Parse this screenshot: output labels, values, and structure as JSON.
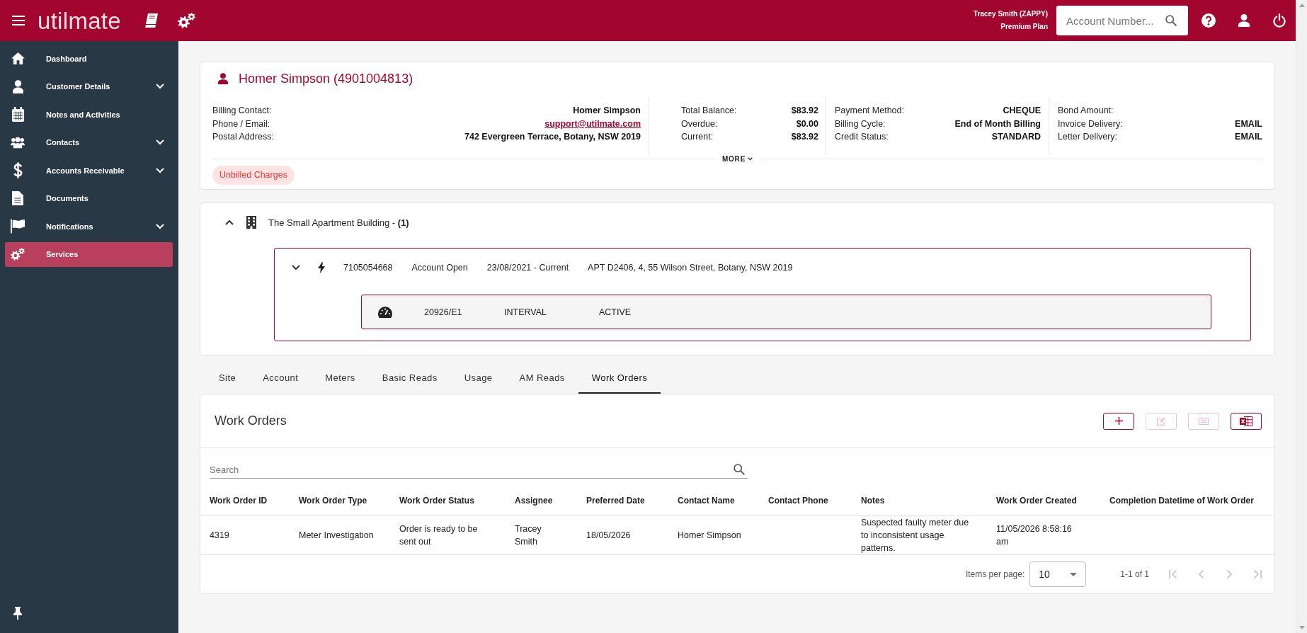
{
  "top_bar": {
    "logo": "utilmate",
    "user_name": "Tracey Smith (ZAPPY)",
    "plan": "Premium Plan",
    "account_search": {
      "placeholder": "Account Number..."
    }
  },
  "sidebar": {
    "items": [
      {
        "label": "Dashboard",
        "expandable": false,
        "selected": false
      },
      {
        "label": "Customer Details",
        "expandable": true,
        "selected": false
      },
      {
        "label": "Notes and Activities",
        "expandable": false,
        "selected": false
      },
      {
        "label": "Contacts",
        "expandable": true,
        "selected": false
      },
      {
        "label": "Accounts Receivable",
        "expandable": true,
        "selected": false
      },
      {
        "label": "Documents",
        "expandable": false,
        "selected": false
      },
      {
        "label": "Notifications",
        "expandable": true,
        "selected": false
      },
      {
        "label": "Services",
        "expandable": false,
        "selected": true
      }
    ]
  },
  "customer": {
    "name": "Homer Simpson (4901004813)",
    "details": [
      [
        {
          "label": "Billing Contact:",
          "value": "Homer Simpson",
          "kind": "text"
        },
        {
          "label": "Phone / Email:",
          "value": "support@utilmate.com",
          "kind": "link"
        },
        {
          "label": "Postal Address:",
          "value": "742 Evergreen Terrace, Botany, NSW 2019",
          "kind": "text"
        }
      ],
      [
        {
          "label": "Total Balance:",
          "value": "$83.92",
          "kind": "text"
        },
        {
          "label": "Overdue:",
          "value": "$0.00",
          "kind": "text"
        },
        {
          "label": "Current:",
          "value": "$83.92",
          "kind": "text"
        }
      ],
      [
        {
          "label": "Payment Method:",
          "value": "CHEQUE",
          "kind": "text"
        },
        {
          "label": "Billing Cycle:",
          "value": "End of Month Billing",
          "kind": "text"
        },
        {
          "label": "Credit Status:",
          "value": "STANDARD",
          "kind": "text"
        }
      ],
      [
        {
          "label": "Bond Amount:"
        },
        {
          "label": "Invoice Delivery:",
          "value": "EMAIL",
          "kind": "text"
        },
        {
          "label": "Letter Delivery:",
          "value": "EMAIL",
          "kind": "text"
        }
      ]
    ],
    "more": "MORE",
    "tags": [
      "Unbilled Charges"
    ]
  },
  "site": {
    "name": "The Small Apartment Building - **(1)**",
    "expanded": true,
    "services": [
      {
        "number": "7105054668",
        "status": "Account Open",
        "period": "23/08/2021 - Current",
        "address": "APT D2406, 4, 55 Wilson Street, Botany, NSW 2019",
        "meters": [
          {
            "number": "20926/E1",
            "type": "INTERVAL",
            "status": "ACTIVE"
          }
        ]
      }
    ]
  },
  "tabs": [
    {
      "label": "Site",
      "selected": false
    },
    {
      "label": "Account",
      "selected": false
    },
    {
      "label": "Meters",
      "selected": false
    },
    {
      "label": "Basic Reads",
      "selected": false
    },
    {
      "label": "Usage",
      "selected": false
    },
    {
      "label": "AM Reads",
      "selected": false
    },
    {
      "label": "Work Orders",
      "selected": true
    }
  ],
  "work_orders": {
    "title": "Work Orders",
    "actions": [
      {
        "disabled": false
      },
      {
        "disabled": true
      },
      {
        "disabled": true
      },
      {
        "disabled": false
      }
    ],
    "search": {
      "placeholder": "Search"
    },
    "table": {
      "columns": [
        "Work Order ID",
        "Work Order Type",
        "Work Order Status",
        "Assignee",
        "Preferred Date",
        "Contact Name",
        "Contact Phone",
        "Notes",
        "Work Order Created",
        "Completion Datetime of Work Order"
      ],
      "rows": [
        [
          "4319",
          "Meter Investigation",
          "Order is ready to be sent out",
          "Tracey Smith",
          "18/05/2026",
          "Homer Simpson",
          null,
          "Suspected faulty meter due to inconsistent usage patterns.",
          "11/05/2026 8:58:16 am",
          null
        ]
      ]
    },
    "paginator": {
      "label": "Items per page:",
      "page_size": "10",
      "range": "1-1 of 1",
      "nav": [
        {
          "disabled": true
        },
        {
          "disabled": true
        },
        {
          "disabled": true
        },
        {
          "disabled": true
        }
      ]
    }
  }
}
